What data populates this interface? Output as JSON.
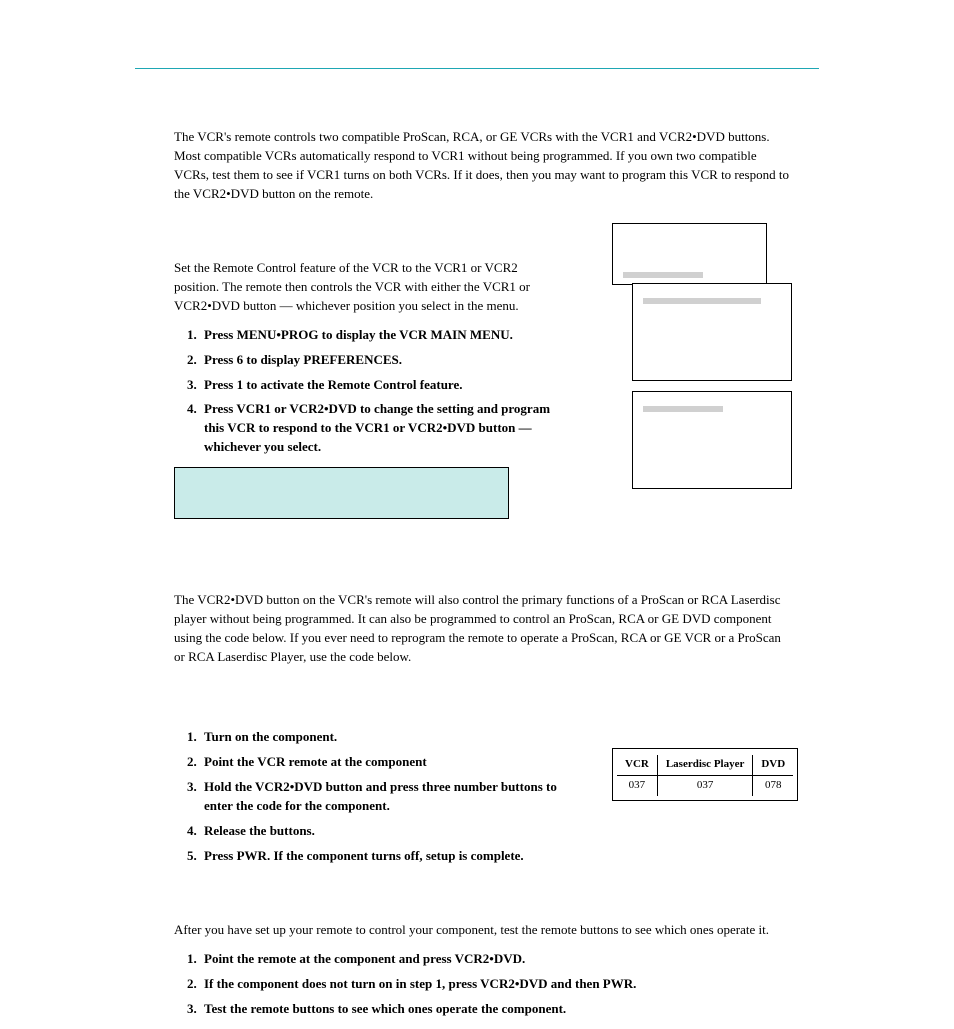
{
  "intro": "The VCR's remote controls two compatible ProScan, RCA, or GE VCRs with the VCR1 and VCR2•DVD buttons.  Most compatible VCRs automatically respond to VCR1 without being programmed.  If you own two compatible VCRs, test them to see if VCR1 turns on both VCRs.  If it does, then you may want to program this VCR to respond to the VCR2•DVD button on the remote.",
  "set_remote_intro": "Set the Remote Control feature of the VCR to the VCR1 or VCR2 position.  The remote then controls the VCR with either the VCR1 or VCR2•DVD button — whichever position you select in the menu.",
  "set_remote_steps": [
    "Press MENU•PROG to display the VCR MAIN MENU.",
    "Press 6 to display PREFERENCES.",
    "Press 1 to activate the Remote Control feature.",
    "Press VCR1 or VCR2•DVD to change the setting and program this VCR to respond to the VCR1 or VCR2•DVD button — whichever you select."
  ],
  "prog_intro": "The VCR2•DVD button on the VCR's remote will also control the primary functions of a ProScan or RCA Laserdisc player without being programmed.  It can also be programmed to control an ProScan, RCA or GE DVD component using the code below.  If you ever need to reprogram the remote to operate a ProScan, RCA or GE VCR or a ProScan or RCA Laserdisc Player, use the code below.",
  "prog_steps": [
    "Turn on the component.",
    "Point the VCR remote at the component",
    "Hold the VCR2•DVD button and press three number buttons to enter the code for the component.",
    "Release the buttons.",
    "Press PWR.  If the component turns off, setup is complete."
  ],
  "codes": {
    "headers": [
      "VCR",
      "Laserdisc Player",
      "DVD"
    ],
    "values": [
      "037",
      "037",
      "078"
    ]
  },
  "test_intro": "After you have set up your remote to control your component, test the remote buttons to see which ones operate it.",
  "test_steps": [
    "Point the remote at the component and press VCR2•DVD.",
    "If the component does not turn on in step 1, press VCR2•DVD and then PWR.",
    "Test the remote buttons to see which ones operate the component."
  ]
}
